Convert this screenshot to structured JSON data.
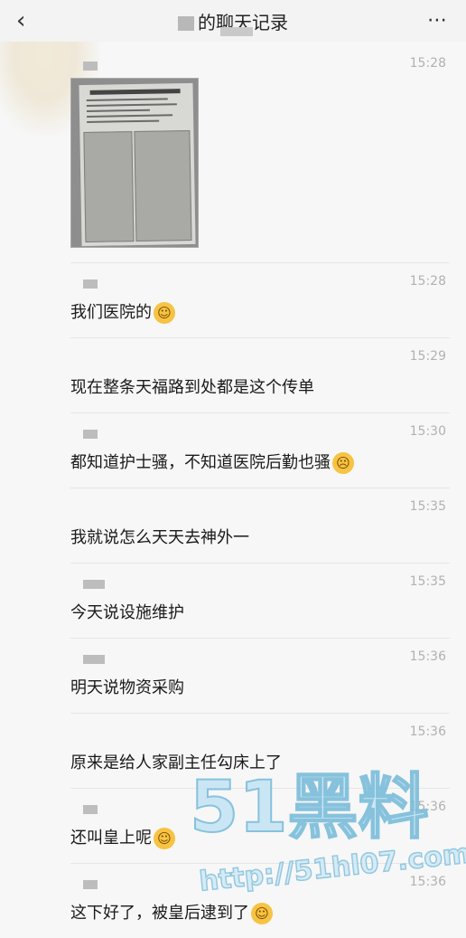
{
  "header": {
    "back_icon": "chevron-left-icon",
    "title": "的聊天记录",
    "more_icon": "ellipsis-icon"
  },
  "messages": [
    {
      "time": "15:28",
      "type": "image"
    },
    {
      "time": "15:28",
      "text": "我们医院的",
      "emoji": "laughing-crying-emoji"
    },
    {
      "time": "15:29",
      "text": "现在整条天福路到处都是这个传单"
    },
    {
      "time": "15:30",
      "text": "都知道护士骚，不知道医院后勤也骚",
      "emoji": "thinking-emoji"
    },
    {
      "time": "15:35",
      "text": "我就说怎么天天去神外一"
    },
    {
      "time": "15:35",
      "text": "今天说设施维护"
    },
    {
      "time": "15:36",
      "text": "明天说物资采购"
    },
    {
      "time": "15:36",
      "text": "原来是给人家副主任勾床上了"
    },
    {
      "time": "15:36",
      "text": "还叫皇上呢",
      "emoji": "laughing-crying-emoji"
    },
    {
      "time": "15:36",
      "text": "这下好了，被皇后逮到了",
      "emoji": "laughing-crying-emoji"
    }
  ],
  "watermark": {
    "brand": "51黑料",
    "url": "http://51hl07.com"
  }
}
